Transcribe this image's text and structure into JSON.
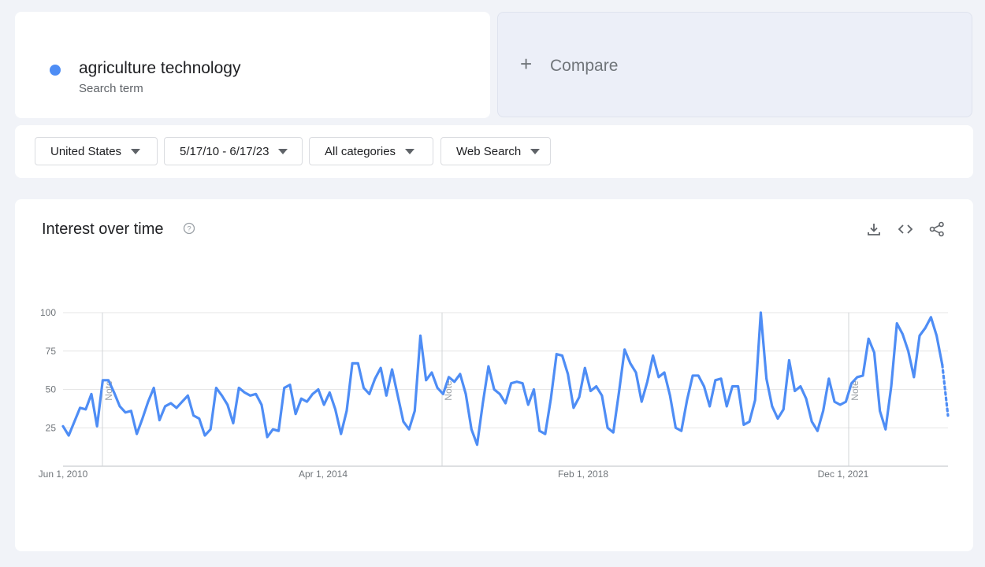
{
  "term": {
    "name": "agriculture technology",
    "subtitle": "Search term",
    "color": "#4e8df5"
  },
  "compare": {
    "plus": "+",
    "label": "Compare"
  },
  "filters": {
    "region": "United States",
    "date_range": "5/17/10 - 6/17/23",
    "category": "All categories",
    "search_type": "Web Search"
  },
  "panel": {
    "title": "Interest over time",
    "help_icon": "help-circle-icon",
    "tools": [
      "download-icon",
      "embed-code-icon",
      "share-icon"
    ]
  },
  "chart_data": {
    "type": "line",
    "ylim": [
      0,
      100
    ],
    "y_ticks": [
      25,
      50,
      75,
      100
    ],
    "x_ticks": [
      "Jun 1, 2010",
      "Apr 1, 2014",
      "Feb 1, 2018",
      "Dec 1, 2021"
    ],
    "notes": [
      "Note",
      "Note",
      "Note"
    ],
    "grid": true,
    "series": [
      {
        "color": "#4e8df5",
        "partial_points": 2,
        "values": [
          26,
          20,
          29,
          38,
          37,
          47,
          26,
          56,
          56,
          48,
          39,
          35,
          36,
          21,
          31,
          42,
          51,
          30,
          39,
          41,
          38,
          42,
          46,
          33,
          31,
          20,
          24,
          51,
          46,
          40,
          28,
          51,
          48,
          46,
          47,
          40,
          19,
          24,
          23,
          51,
          53,
          34,
          44,
          42,
          47,
          50,
          40,
          48,
          37,
          21,
          36,
          67,
          67,
          51,
          47,
          57,
          64,
          46,
          63,
          46,
          29,
          24,
          36,
          85,
          56,
          61,
          51,
          47,
          58,
          55,
          60,
          47,
          24,
          14,
          41,
          65,
          50,
          47,
          41,
          54,
          55,
          54,
          40,
          50,
          23,
          21,
          44,
          73,
          72,
          60,
          38,
          45,
          64,
          49,
          52,
          46,
          25,
          22,
          48,
          76,
          67,
          61,
          42,
          55,
          72,
          58,
          61,
          46,
          25,
          23,
          43,
          59,
          59,
          52,
          39,
          56,
          57,
          39,
          52,
          52,
          27,
          29,
          43,
          100,
          57,
          39,
          31,
          37,
          69,
          49,
          52,
          44,
          29,
          23,
          36,
          57,
          42,
          40,
          42,
          54,
          58,
          59,
          83,
          74,
          36,
          24,
          52,
          93,
          86,
          75,
          58,
          85,
          90,
          97,
          85,
          66,
          33
        ]
      }
    ]
  }
}
